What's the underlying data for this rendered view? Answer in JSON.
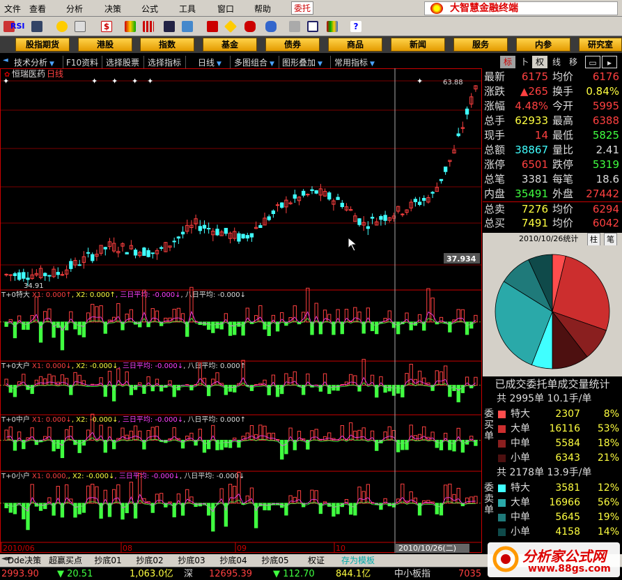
{
  "menu": [
    "文件",
    "查看",
    "分析",
    "决策",
    "公式",
    "工具",
    "窗口",
    "帮助"
  ],
  "menu_active": "委托",
  "brand_title": "大智慧金融终端",
  "toolbar": {
    "rsi_label": "RSI"
  },
  "categories": [
    "股指期货",
    "港股",
    "指数",
    "基金",
    "债券",
    "商品",
    "新闻",
    "服务",
    "内参",
    "研究室"
  ],
  "subnav": [
    "技术分析",
    "F10资料",
    "选择股票",
    "选择指标",
    "日线",
    "多图组合",
    "图形叠加",
    "常用指标"
  ],
  "right_tabs": [
    "标",
    "卜",
    "权",
    "线",
    "移"
  ],
  "stock": {
    "name": "恒瑞医药",
    "period": "日线"
  },
  "kline": {
    "high_label": "63.88",
    "low_label": "34.91",
    "cursor_price": "37.934",
    "dates": [
      "2010/06",
      "08",
      "09",
      "10"
    ],
    "cursor_date": "2010/10/26(二)",
    "cursor_position": 0.825,
    "price_range": [
      34.91,
      63.88
    ]
  },
  "panels": [
    {
      "title": "T+0特大",
      "x1": "X1: 0.000↑",
      "x2": "X2: 0.000↑",
      "a3": "三日平均: -0.000↓",
      "a8": "八日平均: -0.000↓"
    },
    {
      "title": "T+0大户",
      "x1": "X1: 0.000↓",
      "x2": "X2: -0.000↓",
      "a3": "三日平均: -0.000↓",
      "a8": "八日平均: 0.000↑"
    },
    {
      "title": "T+0中户",
      "x1": "X1: 0.000↓",
      "x2": "X2: -0.000↓",
      "a3": "三日平均: -0.000↓",
      "a8": "八日平均: 0.000↑"
    },
    {
      "title": "T+0小户",
      "x1": "X1: 0.000,",
      "x2": "X2: -0.000↓",
      "a3": "三日平均: -0.000↓",
      "a8": "八日平均: -0.000↓"
    }
  ],
  "quote": [
    {
      "l1": "最新",
      "v1": "6175",
      "c1": "#ff4040",
      "l2": "均价",
      "v2": "6176",
      "c2": "#ff4040"
    },
    {
      "l1": "涨跌",
      "v1": "▲265",
      "c1": "#ff4040",
      "l2": "换手",
      "v2": "0.84%",
      "c2": "#ffff40"
    },
    {
      "l1": "涨幅",
      "v1": "4.48%",
      "c1": "#ff4040",
      "l2": "今开",
      "v2": "5995",
      "c2": "#ff4040"
    },
    {
      "l1": "总手",
      "v1": "62933",
      "c1": "#ffff40",
      "l2": "最高",
      "v2": "6388",
      "c2": "#ff4040"
    },
    {
      "l1": "现手",
      "v1": "14",
      "c1": "#ff4040",
      "l2": "最低",
      "v2": "5825",
      "c2": "#40ff40"
    },
    {
      "l1": "总额",
      "v1": "38867",
      "c1": "#40ffff",
      "l2": "量比",
      "v2": "2.41",
      "c2": "#dddddd"
    },
    {
      "l1": "涨停",
      "v1": "6501",
      "c1": "#ff4040",
      "l2": "跌停",
      "v2": "5319",
      "c2": "#40ff40"
    },
    {
      "l1": "总笔",
      "v1": "3381",
      "c1": "#dddddd",
      "l2": "每笔",
      "v2": "18.6",
      "c2": "#dddddd"
    },
    {
      "l1": "内盘",
      "v1": "35491",
      "c1": "#40ff40",
      "l2": "外盘",
      "v2": "27442",
      "c2": "#ff4040"
    },
    {
      "l1": "总卖",
      "v1": "7276",
      "c1": "#ffff40",
      "l2": "均价",
      "v2": "6294",
      "c2": "#ff4040"
    },
    {
      "l1": "总买",
      "v1": "7491",
      "c1": "#ffff40",
      "l2": "均价",
      "v2": "6042",
      "c2": "#ff4040"
    }
  ],
  "pie_header": {
    "date": "2010/10/26统计",
    "b1": "柱",
    "b2": "笔"
  },
  "pie_title": "已成交委托单成交量统计",
  "chart_data": {
    "type": "pie",
    "title": "已成交委托单成交量统计",
    "categories": [
      "买特大",
      "买大单",
      "买中单",
      "买小单",
      "卖特大",
      "卖大单",
      "卖中单",
      "卖小单"
    ],
    "values": [
      2307,
      16116,
      5584,
      6343,
      3581,
      16966,
      5645,
      4158
    ],
    "colors": [
      "#ff4d4d",
      "#cc2e2e",
      "#8a1f1f",
      "#4d1010",
      "#40ffff",
      "#2aa9a9",
      "#1f7a7a",
      "#0f4a4a"
    ]
  },
  "buy_stats": {
    "header": "共 2995单 10.1手/单",
    "side": "委买单",
    "rows": [
      {
        "name": "特大",
        "vol": "2307",
        "pct": "8%",
        "color": "#ff4d4d"
      },
      {
        "name": "大单",
        "vol": "16116",
        "pct": "53%",
        "color": "#cc2e2e"
      },
      {
        "name": "中单",
        "vol": "5584",
        "pct": "18%",
        "color": "#8a1f1f"
      },
      {
        "name": "小单",
        "vol": "6343",
        "pct": "21%",
        "color": "#4d1010"
      }
    ]
  },
  "sell_stats": {
    "header": "共 2178单 13.9手/单",
    "side": "委卖单",
    "rows": [
      {
        "name": "特大",
        "vol": "3581",
        "pct": "12%",
        "color": "#40ffff"
      },
      {
        "name": "大单",
        "vol": "16966",
        "pct": "56%",
        "color": "#2aa9a9"
      },
      {
        "name": "中单",
        "vol": "5645",
        "pct": "19%",
        "color": "#1f7a7a"
      },
      {
        "name": "小单",
        "vol": "4158",
        "pct": "14%",
        "color": "#0f4a4a"
      }
    ]
  },
  "bottom_tabs": [
    "Dde决策",
    "超赢买点",
    "抄底01",
    "抄底02",
    "抄底03",
    "抄底04",
    "抄底05",
    "权证",
    "存为模板"
  ],
  "status": [
    {
      "t": "2993.90",
      "c": "#ff4040"
    },
    {
      "t": "▼ 20.51",
      "c": "#40ff40"
    },
    {
      "t": "1,063.0亿",
      "c": "#ffff40"
    },
    {
      "t": "深",
      "c": "#dddddd"
    },
    {
      "t": "12695.39",
      "c": "#ff4040"
    },
    {
      "t": "▼ 112.70",
      "c": "#40ff40"
    },
    {
      "t": "844.1亿",
      "c": "#ffff40"
    },
    {
      "t": "中小板指",
      "c": "#dddddd"
    },
    {
      "t": "7035",
      "c": "#ff4040"
    }
  ],
  "watermark": {
    "title": "分析家公式网",
    "url": "www.88gs.com"
  }
}
